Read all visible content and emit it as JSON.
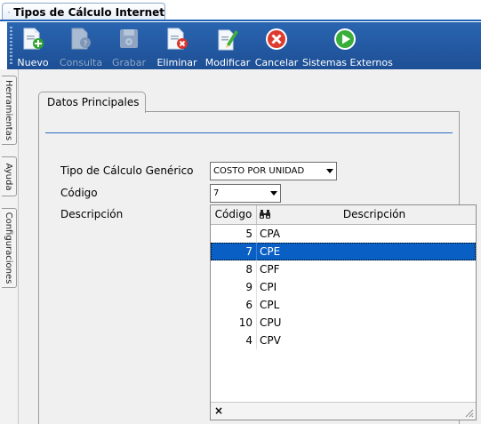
{
  "window": {
    "tab_title": "Tipos de Cálculo Internet"
  },
  "toolbar": {
    "buttons": [
      {
        "label": "Nuevo",
        "icon": "new-document-icon",
        "enabled": true
      },
      {
        "label": "Consulta",
        "icon": "query-document-icon",
        "enabled": false
      },
      {
        "label": "Grabar",
        "icon": "save-disk-icon",
        "enabled": false
      },
      {
        "label": "Eliminar",
        "icon": "delete-document-icon",
        "enabled": true
      },
      {
        "label": "Modificar",
        "icon": "edit-document-icon",
        "enabled": true
      },
      {
        "label": "Cancelar",
        "icon": "cancel-circle-icon",
        "enabled": true
      },
      {
        "label": "Sistemas Externos",
        "icon": "play-circle-icon",
        "enabled": true
      }
    ]
  },
  "side_tabs": [
    "Herramientas",
    "Ayuda",
    "Configuraciones"
  ],
  "panel": {
    "tab_label": "Datos Principales",
    "fields": {
      "tipo_calculo_label": "Tipo de Cálculo Genérico",
      "tipo_calculo_value": "COSTO POR UNIDAD",
      "codigo_label": "Código",
      "codigo_value": "7",
      "descripcion_label": "Descripción"
    }
  },
  "dropdown": {
    "columns": [
      "Código",
      "Descripción"
    ],
    "rows": [
      {
        "codigo": "5",
        "descripcion": "CPA"
      },
      {
        "codigo": "7",
        "descripcion": "CPE"
      },
      {
        "codigo": "8",
        "descripcion": "CPF"
      },
      {
        "codigo": "9",
        "descripcion": "CPI"
      },
      {
        "codigo": "6",
        "descripcion": "CPL"
      },
      {
        "codigo": "10",
        "descripcion": "CPU"
      },
      {
        "codigo": "4",
        "descripcion": "CPV"
      }
    ],
    "selected_index": 1,
    "footer_close": "×"
  },
  "colors": {
    "toolbar": "#245aa0",
    "selection": "#0a5fc4",
    "accent": "#2b6cc0"
  }
}
